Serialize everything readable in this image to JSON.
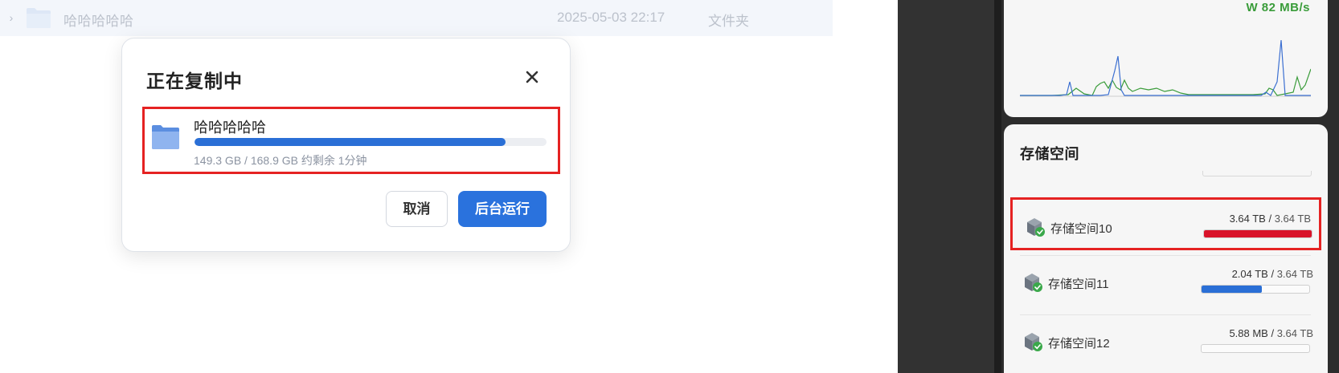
{
  "file_list": {
    "row": {
      "name": "哈哈哈哈哈",
      "modified": "2025-05-03 22:17",
      "type": "文件夹",
      "icon": "folder-icon"
    }
  },
  "copy_dialog": {
    "title": "正在复制中",
    "close_icon": "close-icon",
    "task": {
      "name": "哈哈哈哈哈",
      "progress_fraction": 0.884,
      "info": "149.3 GB / 168.9 GB 约剩余 1分钟",
      "icon": "folder-icon"
    },
    "cancel_label": "取消",
    "background_label": "后台运行",
    "accent_color": "#2a72dd"
  },
  "network": {
    "speed_label": "W 82 MB/s",
    "series_colors": {
      "green": "#3a9c3a",
      "blue": "#3b6fd1"
    }
  },
  "storage": {
    "title": "存储空间",
    "volumes": [
      {
        "name": "存储空间10",
        "used": "3.64 TB",
        "total": "3.64 TB",
        "usage_fraction": 1.0,
        "bar_color": "#d9132a",
        "icon": "storage-volume-icon"
      },
      {
        "name": "存储空间11",
        "used": "2.04 TB",
        "total": "3.64 TB",
        "usage_fraction": 0.56,
        "bar_color": "#2a6fd6",
        "icon": "storage-volume-icon"
      },
      {
        "name": "存储空间12",
        "used": "5.88 MB",
        "total": "3.64 TB",
        "usage_fraction": 0.0,
        "bar_color": "#2a6fd6",
        "icon": "storage-volume-icon"
      }
    ]
  }
}
